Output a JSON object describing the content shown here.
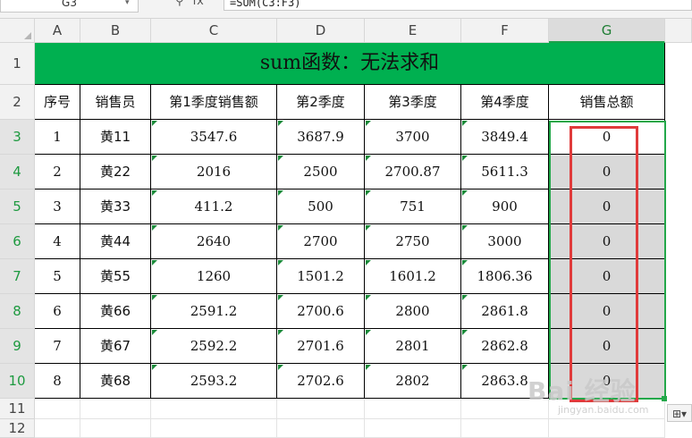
{
  "formula_bar": {
    "name_box": "G3",
    "zoom_icon": "zoom-icon",
    "fx_label": "fx",
    "formula": "=SUM(C3:F3)"
  },
  "columns": [
    "A",
    "B",
    "C",
    "D",
    "E",
    "F",
    "G"
  ],
  "rows": [
    "1",
    "2",
    "3",
    "4",
    "5",
    "6",
    "7",
    "8",
    "9",
    "10",
    "11",
    "12"
  ],
  "title": "sum函数：无法求和",
  "headers": [
    "序号",
    "销售员",
    "第1季度销售额",
    "第2季度",
    "第3季度",
    "第4季度",
    "销售总额"
  ],
  "table": [
    [
      "1",
      "黄11",
      "3547.6",
      "3687.9",
      "3700",
      "3849.4",
      "0"
    ],
    [
      "2",
      "黄22",
      "2016",
      "2500",
      "2700.87",
      "5611.3",
      "0"
    ],
    [
      "3",
      "黄33",
      "411.2",
      "500",
      "751",
      "900",
      "0"
    ],
    [
      "4",
      "黄44",
      "2640",
      "2700",
      "2750",
      "3000",
      "0"
    ],
    [
      "5",
      "黄55",
      "1260",
      "1501.2",
      "1601.2",
      "1806.36",
      "0"
    ],
    [
      "6",
      "黄66",
      "2591.2",
      "2700.6",
      "2800",
      "2861.8",
      "0"
    ],
    [
      "7",
      "黄67",
      "2592.2",
      "2701.6",
      "2801",
      "2862.8",
      "0"
    ],
    [
      "8",
      "黄68",
      "2593.2",
      "2702.6",
      "2802",
      "2863.8",
      "0"
    ]
  ],
  "colors": {
    "title_fill": "#00b050",
    "selection": "#23a84a",
    "highlight": "#e03b3b",
    "selected_fill": "#d9d9d9"
  },
  "watermark": {
    "main": "Bai 经验",
    "sub": "jingyan.baidu.com"
  },
  "paste_options_icon": "paste-options-icon"
}
